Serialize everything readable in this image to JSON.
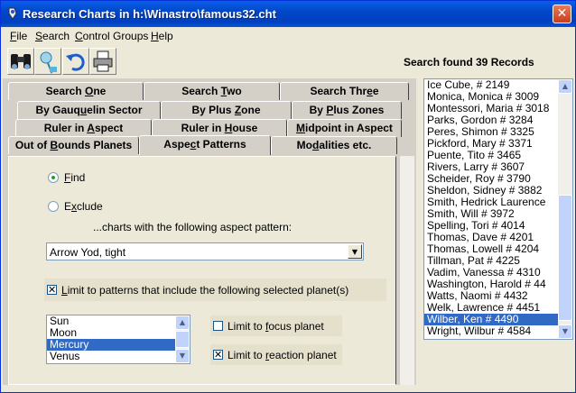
{
  "window": {
    "title": "Research Charts in h:\\Winastro\\famous32.cht",
    "close_glyph": "✕"
  },
  "menu": {
    "items": [
      {
        "key": "F",
        "rest": "ile"
      },
      {
        "key": "S",
        "rest": "earch"
      },
      {
        "key": "C",
        "rest": "ontrol Groups"
      },
      {
        "key": "H",
        "rest": "elp"
      }
    ]
  },
  "toolbar": {
    "buttons": [
      {
        "icon": "binoculars-icon"
      },
      {
        "icon": "chart-wheel-icon"
      },
      {
        "icon": "undo-arrow-icon"
      },
      {
        "icon": "printer-icon"
      }
    ]
  },
  "status": "Search found 39 Records",
  "tabs": {
    "row1": [
      {
        "pre": "Search ",
        "key": "O",
        "post": "ne"
      },
      {
        "pre": "Search ",
        "key": "T",
        "post": "wo"
      },
      {
        "pre": "Search Thr",
        "key": "e",
        "post": "e"
      }
    ],
    "row2": [
      {
        "pre": "By Gauq",
        "key": "u",
        "post": "elin Sector"
      },
      {
        "pre": "By Plus ",
        "key": "Z",
        "post": "one"
      },
      {
        "pre": "By ",
        "key": "P",
        "post": "lus Zones"
      }
    ],
    "row3": [
      {
        "pre": "Ruler in ",
        "key": "A",
        "post": "spect"
      },
      {
        "pre": "Ruler in ",
        "key": "H",
        "post": "ouse"
      },
      {
        "pre": "",
        "key": "M",
        "post": "idpoint in Aspect"
      }
    ],
    "row4": [
      {
        "pre": "Out of ",
        "key": "B",
        "post": "ounds Planets"
      },
      {
        "pre": "Aspe",
        "key": "c",
        "post": "t Patterns"
      },
      {
        "pre": "Mo",
        "key": "d",
        "post": "alities etc."
      }
    ]
  },
  "form": {
    "find": {
      "key": "F",
      "rest": "ind",
      "selected": true
    },
    "exclude": {
      "key": "x",
      "pre": "E",
      "rest": "clude",
      "selected": false
    },
    "charts_label": "...charts with the following aspect pattern:",
    "pattern_value": "Arrow Yod, tight",
    "limit_patterns": {
      "pre": "",
      "key": "L",
      "rest": "imit to patterns that include the following selected planet(s)",
      "checked": true
    },
    "planets": [
      "Sun",
      "Moon",
      "Mercury",
      "Venus"
    ],
    "selected_planet": "Mercury",
    "limit_focus": {
      "pre": "Limit to ",
      "key": "f",
      "rest": "ocus planet",
      "checked": false
    },
    "limit_reaction": {
      "pre": "Limit to ",
      "key": "r",
      "rest": "eaction planet",
      "checked": true
    }
  },
  "records": [
    "Ice Cube,   # 2149",
    "Monica, Monica  # 3009",
    "Montessori, Maria  # 3018",
    "Parks, Gordon  # 3284",
    "Peres, Shimon  # 3325",
    "Pickford, Mary  # 3371",
    "Puente, Tito  # 3465",
    "Rivers, Larry  # 3607",
    "Scheider, Roy  # 3790",
    "Sheldon, Sidney  # 3882",
    "Smith, Hedrick Laurence",
    "Smith, Will  # 3972",
    "Spelling, Tori  # 4014",
    "Thomas, Dave  # 4201",
    "Thomas, Lowell  # 4204",
    "Tillman, Pat  # 4225",
    "Vadim, Vanessa  # 4310",
    "Washington, Harold  # 44",
    "Watts, Naomi  # 4432",
    "Welk, Lawrence  # 4451",
    "Wilber, Ken  # 4490",
    "Wright, Wilbur  # 4584"
  ],
  "selected_record": "Wilber, Ken  # 4490",
  "colors": {
    "title_bar": "#0047c8",
    "selection": "#316ac5",
    "panel": "#d4d0c8"
  }
}
